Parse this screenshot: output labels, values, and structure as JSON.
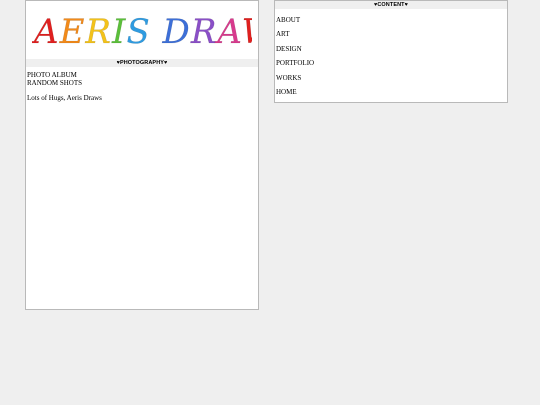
{
  "left_panel": {
    "logo_text": "AERIS DRAWS",
    "logo_colors": [
      "#e0201f",
      "#f28a1a",
      "#f3c21a",
      "#5bbf3a",
      "#2f9be0",
      "#3d6fd8",
      "#8a4fc7",
      "#d83a8d",
      "#e0201f",
      "#f3c21a",
      "#5bbf3a"
    ],
    "section_header": "♥PHOTOGRAPHY♥",
    "links": [
      "PHOTO ALBUM",
      "RANDOM SHOTS"
    ],
    "signoff": "Lots of Hugs, Aeris Draws"
  },
  "right_panel": {
    "section_header": "♥CONTENT♥",
    "nav_items": [
      "ABOUT",
      "ART",
      "DESIGN",
      "PORTFOLIO",
      "WORKS",
      "HOME"
    ]
  }
}
